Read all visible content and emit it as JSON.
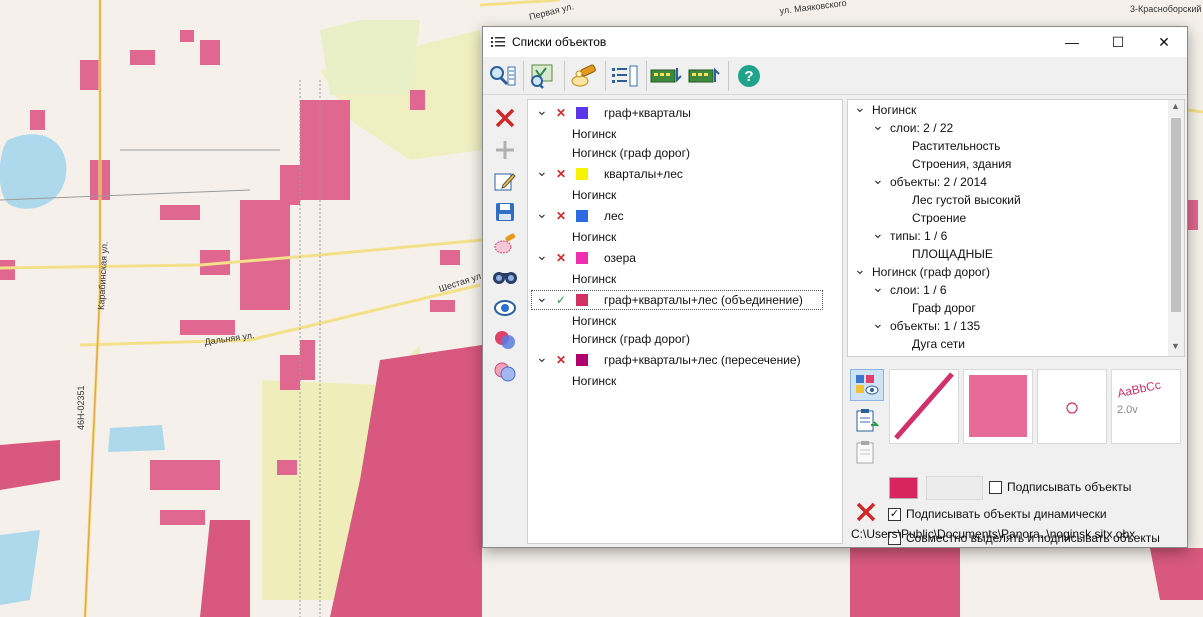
{
  "window": {
    "title": "Списки объектов",
    "minimize_label": "—",
    "maximize_label": "☐",
    "close_label": "✕"
  },
  "toolbar": {
    "icons": [
      "find-icon",
      "map-select-icon",
      "flashlight-icon",
      "list-settings-icon",
      "export-icon",
      "import-icon",
      "help-icon"
    ]
  },
  "left_tools": [
    "delete-icon",
    "add-icon",
    "edit-icon",
    "save-icon",
    "highlight-icon",
    "binoculars-icon",
    "eye-icon",
    "union-icon",
    "intersection-icon"
  ],
  "lists": [
    {
      "name": "граф+кварталы",
      "color": "#5b35e8",
      "status": "x",
      "children": [
        "Ногинск",
        "Ногинск (граф дорог)"
      ]
    },
    {
      "name": "кварталы+лес",
      "color": "#f7f200",
      "status": "x",
      "children": [
        "Ногинск"
      ]
    },
    {
      "name": "лес",
      "color": "#2e6be0",
      "status": "x",
      "children": [
        "Ногинск"
      ]
    },
    {
      "name": "озера",
      "color": "#ee2fb0",
      "status": "x",
      "children": [
        "Ногинск"
      ]
    },
    {
      "name": "граф+кварталы+лес (объединение)",
      "color": "#d2305f",
      "status": "check",
      "children": [
        "Ногинск",
        "Ногинск (граф дорог)"
      ]
    },
    {
      "name": "граф+кварталы+лес (пересечение)",
      "color": "#b0006e",
      "status": "x",
      "children": [
        "Ногинск"
      ]
    }
  ],
  "details": {
    "rows": [
      {
        "level": 0,
        "chev": true,
        "text": "Ногинск"
      },
      {
        "level": 1,
        "chev": true,
        "text": "слои: 2 / 22"
      },
      {
        "level": 2,
        "chev": false,
        "text": "Растительность"
      },
      {
        "level": 2,
        "chev": false,
        "text": "Строения, здания"
      },
      {
        "level": 1,
        "chev": true,
        "text": "объекты: 2 / 2014"
      },
      {
        "level": 2,
        "chev": false,
        "text": "Лес густой высокий"
      },
      {
        "level": 2,
        "chev": false,
        "text": "Строение"
      },
      {
        "level": 1,
        "chev": true,
        "text": "типы: 1 / 6"
      },
      {
        "level": 2,
        "chev": false,
        "text": "ПЛОЩАДНЫЕ"
      },
      {
        "level": 0,
        "chev": true,
        "text": "Ногинск (граф дорог)"
      },
      {
        "level": 1,
        "chev": true,
        "text": "слои: 1 / 6"
      },
      {
        "level": 2,
        "chev": false,
        "text": "Граф дорог"
      },
      {
        "level": 1,
        "chev": true,
        "text": "объекты: 1 / 135"
      },
      {
        "level": 2,
        "chev": false,
        "text": "Дуга сети"
      }
    ]
  },
  "style": {
    "sample_text": "AaBbCc",
    "sample_size": "2.0v",
    "line_color": "#d2306a",
    "fill_color": "#e76a97",
    "point_color": "#d2306a",
    "swatch_color": "#d8245f",
    "label_objects": "Подписывать объекты",
    "label_objects_checked": false,
    "label_dynamic": "Подписывать объекты динамически",
    "label_dynamic_checked": true,
    "select_and_label": "Совместно выделять и подписывать объекты",
    "select_and_label_checked": false,
    "file_path": "C:\\Users\\Public\\Documents\\Panora..\\noginsk.sitx.obx"
  },
  "map": {
    "labels": [
      "Первая ул.",
      "ул. Маяковского",
      "Карабинская ул.",
      "Дальняя ул.",
      "Шестая ул.",
      "46Н-02351",
      "3-Красноборский"
    ]
  }
}
